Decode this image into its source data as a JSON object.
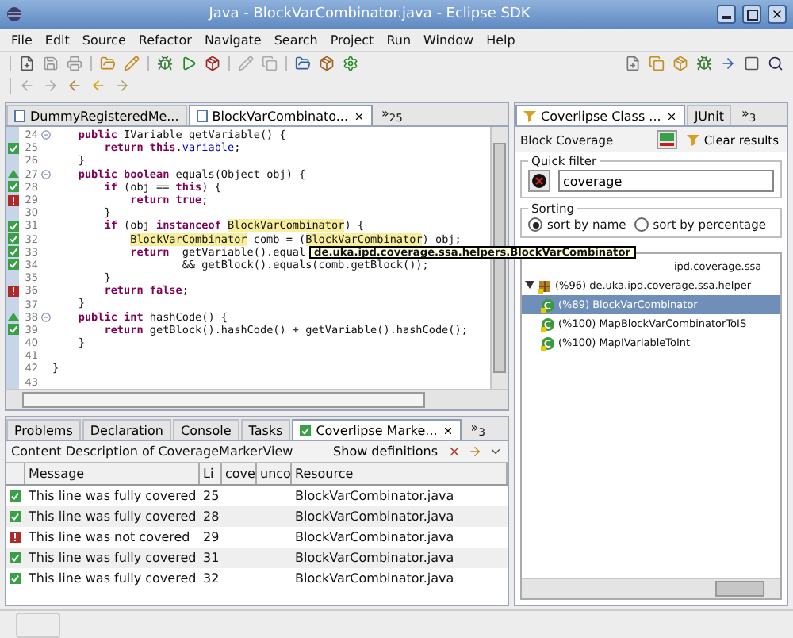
{
  "window": {
    "title": "Java - BlockVarCombinator.java - Eclipse SDK"
  },
  "menu": [
    "File",
    "Edit",
    "Source",
    "Refactor",
    "Navigate",
    "Search",
    "Project",
    "Run",
    "Window",
    "Help"
  ],
  "editor": {
    "tabs": [
      {
        "label": "DummyRegisteredMe...",
        "selected": false
      },
      {
        "label": "BlockVarCombinato...",
        "selected": true
      }
    ],
    "overflow": "»$_{25}$",
    "lines": [
      {
        "number": "24",
        "kind": "plain",
        "fold": true,
        "segments": [
          {
            "text": "    public",
            "kind": "keyword"
          },
          {
            "text": " IVariable getVariable() {"
          }
        ]
      },
      {
        "number": "25",
        "kind": "covered",
        "fold": false,
        "segments": [
          {
            "text": "        return",
            "kind": "keyword"
          },
          {
            "text": " this",
            "kind": "keyword"
          },
          {
            "text": "."
          },
          {
            "text": "variable",
            "kind": "field"
          },
          {
            "text": ";"
          }
        ]
      },
      {
        "number": "26",
        "kind": "plain",
        "fold": false,
        "segments": [
          {
            "text": "    }"
          }
        ]
      },
      {
        "number": "27",
        "kind": "partial",
        "fold": true,
        "segments": [
          {
            "text": "    public",
            "kind": "keyword"
          },
          {
            "text": " boolean",
            "kind": "keyword"
          },
          {
            "text": " equals(Object obj) {"
          }
        ]
      },
      {
        "number": "28",
        "kind": "covered",
        "fold": false,
        "segments": [
          {
            "text": "        if",
            "kind": "keyword"
          },
          {
            "text": " (obj == "
          },
          {
            "text": "this",
            "kind": "keyword"
          },
          {
            "text": ") {"
          }
        ]
      },
      {
        "number": "29",
        "kind": "missed",
        "fold": false,
        "segments": [
          {
            "text": "            return",
            "kind": "keyword"
          },
          {
            "text": " true",
            "kind": "keyword"
          },
          {
            "text": ";"
          }
        ]
      },
      {
        "number": "30",
        "kind": "plain",
        "fold": false,
        "segments": [
          {
            "text": "        }"
          }
        ]
      },
      {
        "number": "31",
        "kind": "covered",
        "fold": false,
        "segments": [
          {
            "text": "        if",
            "kind": "keyword"
          },
          {
            "text": " (obj "
          },
          {
            "text": "instanceof",
            "kind": "keyword"
          },
          {
            "text": " BlockVarCombinator",
            "kind": "highlight"
          },
          {
            "text": ") {"
          }
        ]
      },
      {
        "number": "32",
        "kind": "covered",
        "fold": false,
        "segments": [
          {
            "text": "            BlockVarCombinator",
            "kind": "highlight"
          },
          {
            "text": " comb = ("
          },
          {
            "text": "BlockVarCombinator",
            "kind": "highlight"
          },
          {
            "text": ") obj;"
          }
        ]
      },
      {
        "number": "33",
        "kind": "covered",
        "fold": false,
        "segments": [
          {
            "text": "            return",
            "kind": "keyword"
          },
          {
            "text": "  getVariable().equal"
          }
        ]
      },
      {
        "number": "34",
        "kind": "covered",
        "fold": false,
        "segments": [
          {
            "text": "                    && getBlock().equals(comb.getBlock());"
          }
        ]
      },
      {
        "number": "35",
        "kind": "plain",
        "fold": false,
        "segments": [
          {
            "text": "        }"
          }
        ]
      },
      {
        "number": "36",
        "kind": "missed",
        "fold": false,
        "segments": [
          {
            "text": "        return",
            "kind": "keyword"
          },
          {
            "text": " false",
            "kind": "keyword"
          },
          {
            "text": ";"
          }
        ]
      },
      {
        "number": "37",
        "kind": "plain",
        "fold": false,
        "segments": [
          {
            "text": "    }"
          }
        ]
      },
      {
        "number": "38",
        "kind": "partial",
        "fold": true,
        "segments": [
          {
            "text": "    public",
            "kind": "keyword"
          },
          {
            "text": " int",
            "kind": "keyword"
          },
          {
            "text": " hashCode() {"
          }
        ]
      },
      {
        "number": "39",
        "kind": "covered",
        "fold": false,
        "segments": [
          {
            "text": "        return",
            "kind": "keyword"
          },
          {
            "text": " getBlock().hashCode() + getVariable().hashCode();"
          }
        ]
      },
      {
        "number": "40",
        "kind": "plain",
        "fold": false,
        "segments": [
          {
            "text": "    }"
          }
        ]
      },
      {
        "number": "41",
        "kind": "plain",
        "fold": false
      },
      {
        "number": "42",
        "kind": "plain",
        "fold": false,
        "segments": [
          {
            "text": "}"
          }
        ]
      },
      {
        "number": "43",
        "kind": "plain",
        "fold": false
      }
    ],
    "tooltip": "de.uka.ipd.coverage.ssa.helpers.BlockVarCombinator"
  },
  "bottom_panel": {
    "tabs": [
      {
        "label": "Problems",
        "selected": false
      },
      {
        "label": "Declaration",
        "selected": false
      },
      {
        "label": "Console",
        "selected": false
      },
      {
        "label": "Tasks",
        "selected": false
      },
      {
        "label": "Coverlipse Marke...",
        "selected": true
      }
    ],
    "overflow": "»$_{3}$",
    "description": "Content Description of CoverageMarkerView",
    "show_definitions": "Show definitions",
    "columns": [
      "Message",
      "Li",
      "cove",
      "unco",
      "Resource"
    ],
    "rows": [
      {
        "kind": "covered",
        "message": "This line was fully covered",
        "line": "25",
        "resource": "BlockVarCombinator.java"
      },
      {
        "kind": "covered",
        "message": "This line was fully covered",
        "line": "28",
        "resource": "BlockVarCombinator.java"
      },
      {
        "kind": "missed",
        "message": "This line was not covered",
        "line": "29",
        "resource": "BlockVarCombinator.java"
      },
      {
        "kind": "covered",
        "message": "This line was fully covered",
        "line": "31",
        "resource": "BlockVarCombinator.java"
      },
      {
        "kind": "covered",
        "message": "This line was fully covered",
        "line": "32",
        "resource": "BlockVarCombinator.java"
      }
    ]
  },
  "class_view": {
    "tabs": [
      {
        "label": "Coverlipse Class ...",
        "selected": true
      },
      {
        "label": "JUnit",
        "selected": false
      }
    ],
    "overflow": "»$_{3}$",
    "title": "Block Coverage",
    "clear_button": "Clear results",
    "quick_filter": {
      "label": "Quick filter",
      "value": "coverage"
    },
    "sorting": {
      "label": "Sorting",
      "options": [
        {
          "label": "sort by name",
          "selected": true
        },
        {
          "label": "sort by percentage",
          "selected": false
        }
      ]
    },
    "tree": [
      {
        "label": "ipd.coverage.ssa",
        "kind": "partial-package"
      },
      {
        "label": "(%96) de.uka.ipd.coverage.ssa.helper",
        "kind": "package",
        "expanded": true,
        "children": [
          {
            "label": "(%89) BlockVarCombinator",
            "kind": "class",
            "selected": true
          },
          {
            "label": "(%100) MapBlockVarCombinatorToIS",
            "kind": "class",
            "selected": false
          },
          {
            "label": "(%100) MapIVariableToInt",
            "kind": "class",
            "selected": false
          }
        ]
      }
    ]
  }
}
